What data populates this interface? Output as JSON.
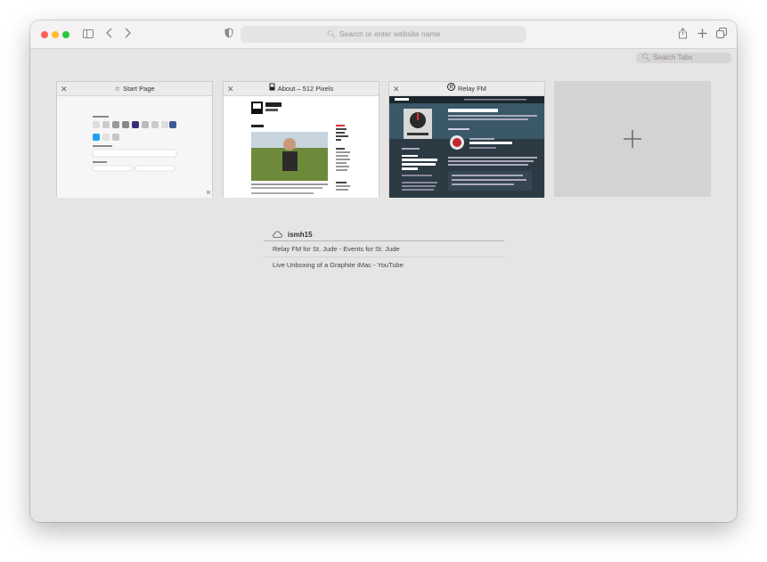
{
  "toolbar": {
    "address_placeholder": "Search or enter website name"
  },
  "tab_overview": {
    "search_placeholder": "Search Tabs",
    "tabs": [
      {
        "title": "Start Page",
        "icon": "star-icon"
      },
      {
        "title": "About – 512 Pixels",
        "icon": "512-pixels-favicon"
      },
      {
        "title": "Relay FM",
        "icon": "relay-fm-favicon"
      }
    ],
    "new_tab_icon": "plus-icon"
  },
  "icloud_tabs": {
    "device": "ismh15",
    "items": [
      "Relay FM for St. Jude - Events for St. Jude",
      "Live Unboxing of a Graphite iMac - YouTube"
    ]
  },
  "colors": {
    "close": "#ff5f57",
    "minimize": "#febc2e",
    "zoom": "#28c840",
    "window_bg": "#e7e4e4"
  }
}
